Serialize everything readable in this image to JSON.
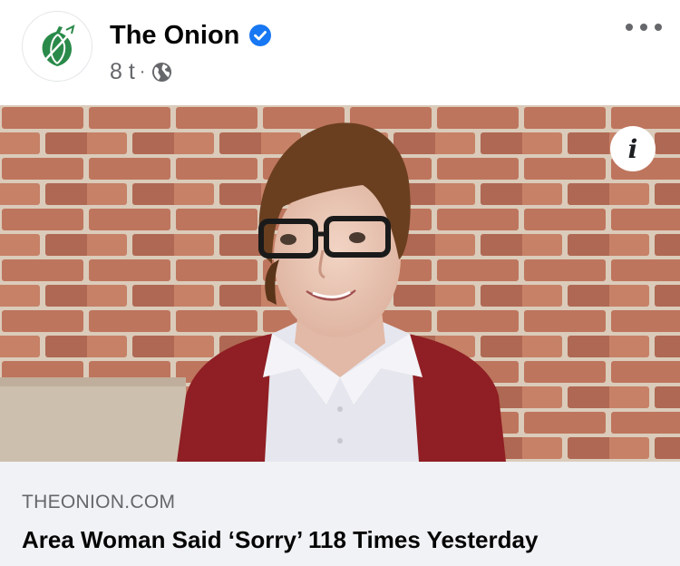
{
  "post": {
    "page_name": "The Onion",
    "timestamp": "8 t",
    "separator": "·",
    "audience_icon": "globe-icon",
    "more_icon": "more-options-icon",
    "verified_icon": "verified-badge-icon",
    "accent_color": "#1877f2",
    "logo_color": "#2a8a4a"
  },
  "link_preview": {
    "domain": "THEONION.COM",
    "headline": "Area Woman Said ‘Sorry’ 118 Times Yesterday",
    "info_label": "i"
  }
}
